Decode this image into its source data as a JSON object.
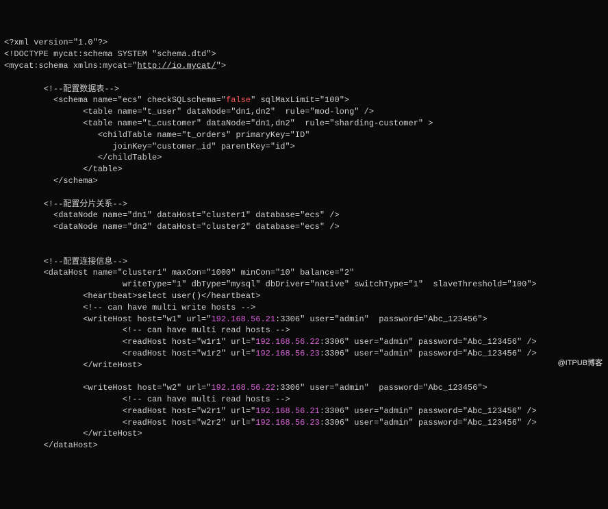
{
  "watermark": "@ITPUB博客",
  "lines": [
    {
      "indent": 0,
      "segs": [
        {
          "t": "<?xml version=\"1.0\"?>"
        }
      ]
    },
    {
      "indent": 0,
      "segs": [
        {
          "t": "<!DOCTYPE mycat:schema SYSTEM \"schema.dtd\">"
        }
      ]
    },
    {
      "indent": 0,
      "segs": [
        {
          "t": "<mycat:schema xmlns:mycat=\""
        },
        {
          "t": "http://io.mycat/",
          "c": "url"
        },
        {
          "t": "\">"
        }
      ]
    },
    {
      "indent": 0,
      "segs": [
        {
          "t": " "
        }
      ]
    },
    {
      "indent": 8,
      "segs": [
        {
          "t": "<!--配置数据表-->"
        }
      ]
    },
    {
      "indent": 10,
      "segs": [
        {
          "t": "<schema name=\"ecs\" checkSQLschema=\""
        },
        {
          "t": "false",
          "c": "false"
        },
        {
          "t": "\" sqlMaxLimit=\"100\">"
        }
      ]
    },
    {
      "indent": 16,
      "segs": [
        {
          "t": "<table name=\"t_user\" dataNode=\"dn1,dn2\"  rule=\"mod-long\" />"
        }
      ]
    },
    {
      "indent": 16,
      "segs": [
        {
          "t": "<table name=\"t_customer\" dataNode=\"dn1,dn2\"  rule=\"sharding-customer\" >"
        }
      ]
    },
    {
      "indent": 19,
      "segs": [
        {
          "t": "<childTable name=\"t_orders\" primaryKey=\"ID\""
        }
      ]
    },
    {
      "indent": 22,
      "segs": [
        {
          "t": "joinKey=\"customer_id\" parentKey=\"id\">"
        }
      ]
    },
    {
      "indent": 19,
      "segs": [
        {
          "t": "</childTable>"
        }
      ]
    },
    {
      "indent": 16,
      "segs": [
        {
          "t": "</table>"
        }
      ]
    },
    {
      "indent": 10,
      "segs": [
        {
          "t": "</schema>"
        }
      ]
    },
    {
      "indent": 0,
      "segs": [
        {
          "t": " "
        }
      ]
    },
    {
      "indent": 8,
      "segs": [
        {
          "t": "<!--配置分片关系-->"
        }
      ]
    },
    {
      "indent": 10,
      "segs": [
        {
          "t": "<dataNode name=\"dn1\" dataHost=\"cluster1\" database=\"ecs\" />"
        }
      ]
    },
    {
      "indent": 10,
      "segs": [
        {
          "t": "<dataNode name=\"dn2\" dataHost=\"cluster2\" database=\"ecs\" />"
        }
      ]
    },
    {
      "indent": 0,
      "segs": [
        {
          "t": " "
        }
      ]
    },
    {
      "indent": 0,
      "segs": [
        {
          "t": " "
        }
      ]
    },
    {
      "indent": 8,
      "segs": [
        {
          "t": "<!--配置连接信息-->"
        }
      ]
    },
    {
      "indent": 8,
      "segs": [
        {
          "t": "<dataHost name=\"cluster1\" maxCon=\"1000\" minCon=\"10\" balance=\"2\""
        }
      ]
    },
    {
      "indent": 24,
      "segs": [
        {
          "t": "writeType=\"1\" dbType=\"mysql\" dbDriver=\"native\" switchType=\"1\"  slaveThreshold=\"100\">"
        }
      ]
    },
    {
      "indent": 16,
      "segs": [
        {
          "t": "<heartbeat>select user()</heartbeat>"
        }
      ]
    },
    {
      "indent": 16,
      "segs": [
        {
          "t": "<!-- can have multi write hosts -->"
        }
      ]
    },
    {
      "indent": 16,
      "segs": [
        {
          "t": "<writeHost host=\"w1\" url=\""
        },
        {
          "t": "192.168.56.21",
          "c": "ip"
        },
        {
          "t": ":3306\" user=\"admin\"  password=\"Abc_123456\">"
        }
      ]
    },
    {
      "indent": 24,
      "segs": [
        {
          "t": "<!-- can have multi read hosts -->"
        }
      ]
    },
    {
      "indent": 24,
      "segs": [
        {
          "t": "<readHost host=\"w1r1\" url=\""
        },
        {
          "t": "192.168.56.22",
          "c": "ip"
        },
        {
          "t": ":3306\" user=\"admin\" password=\"Abc_123456\" />"
        }
      ]
    },
    {
      "indent": 24,
      "segs": [
        {
          "t": "<readHost host=\"w1r2\" url=\""
        },
        {
          "t": "192.168.56.23",
          "c": "ip"
        },
        {
          "t": ":3306\" user=\"admin\" password=\"Abc_123456\" />"
        }
      ]
    },
    {
      "indent": 16,
      "segs": [
        {
          "t": "</writeHost>"
        }
      ]
    },
    {
      "indent": 0,
      "segs": [
        {
          "t": " "
        }
      ]
    },
    {
      "indent": 16,
      "segs": [
        {
          "t": "<writeHost host=\"w2\" url=\""
        },
        {
          "t": "192.168.56.22",
          "c": "ip"
        },
        {
          "t": ":3306\" user=\"admin\"  password=\"Abc_123456\">"
        }
      ]
    },
    {
      "indent": 24,
      "segs": [
        {
          "t": "<!-- can have multi read hosts -->"
        }
      ]
    },
    {
      "indent": 24,
      "segs": [
        {
          "t": "<readHost host=\"w2r1\" url=\""
        },
        {
          "t": "192.168.56.21",
          "c": "ip"
        },
        {
          "t": ":3306\" user=\"admin\" password=\"Abc_123456\" />"
        }
      ]
    },
    {
      "indent": 24,
      "segs": [
        {
          "t": "<readHost host=\"w2r2\" url=\""
        },
        {
          "t": "192.168.56.23",
          "c": "ip"
        },
        {
          "t": ":3306\" user=\"admin\" password=\"Abc_123456\" />"
        }
      ]
    },
    {
      "indent": 16,
      "segs": [
        {
          "t": "</writeHost>"
        }
      ]
    },
    {
      "indent": 8,
      "segs": [
        {
          "t": "</dataHost>"
        }
      ]
    }
  ]
}
